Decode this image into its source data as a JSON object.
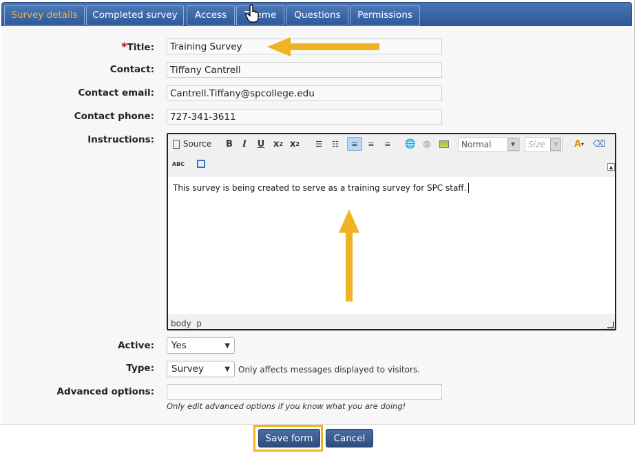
{
  "tabs": [
    {
      "label": "Survey details"
    },
    {
      "label": "Completed survey"
    },
    {
      "label": "Access"
    },
    {
      "label": "Theme"
    },
    {
      "label": "Questions"
    },
    {
      "label": "Permissions"
    }
  ],
  "form": {
    "title_label": "Title:",
    "title_value": "Training Survey",
    "contact_label": "Contact:",
    "contact_value": "Tiffany Cantrell",
    "email_label": "Contact email:",
    "email_value": "Cantrell.Tiffany@spcollege.edu",
    "phone_label": "Contact phone:",
    "phone_value": "727-341-3611",
    "instructions_label": "Instructions:",
    "active_label": "Active:",
    "active_value": "Yes",
    "type_label": "Type:",
    "type_value": "Survey",
    "type_hint": "Only affects messages displayed to visitors.",
    "advanced_label": "Advanced options:",
    "advanced_value": "",
    "advanced_hint": "Only edit advanced options if you know what you are doing!"
  },
  "editor": {
    "source_label": "Source",
    "format_value": "Normal",
    "size_placeholder": "Size",
    "content": "This survey is being created to serve as a training survey for SPC staff.",
    "status_path": "body  p"
  },
  "buttons": {
    "save": "Save form",
    "cancel": "Cancel"
  },
  "colors": {
    "tab_active_text": "#f5b52b",
    "annotation_arrow": "#f0b323",
    "button_bg": "#2c4c7c"
  }
}
